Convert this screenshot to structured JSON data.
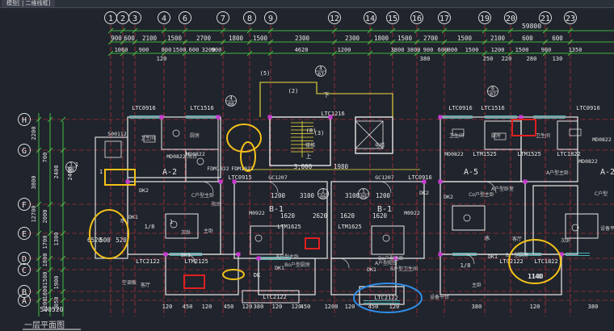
{
  "window": {
    "tab_label": "模型[ | 二维线框]"
  },
  "grid_axes": {
    "top": [
      "1",
      "2",
      "3",
      "4",
      "6",
      "7",
      "8",
      "9",
      "12",
      "14",
      "15",
      "16",
      "17",
      "19",
      "20",
      "21",
      "23"
    ],
    "left": [
      "H",
      "G",
      "F",
      "E",
      "D",
      "C",
      "B",
      "A"
    ]
  },
  "dims": {
    "overall": "59800",
    "top_row1": [
      "900",
      "600",
      "2100",
      "1500",
      "2700",
      "1800",
      "1500",
      "2300",
      "2300",
      "1800",
      "1500",
      "2700",
      "1500",
      "2100",
      "600",
      "600"
    ],
    "top_row2": [
      "1060",
      "900",
      "800",
      "1500",
      "600",
      "3200",
      "900",
      "4620",
      "1200",
      "3800",
      "3800",
      "900",
      "600",
      "800",
      "1500",
      "1200",
      "1500",
      "900",
      "1350"
    ],
    "top_row3": [
      "120",
      "380",
      "250",
      "220",
      "280",
      "130"
    ],
    "left_col": [
      "2200",
      "700",
      "2400",
      "3800",
      "12700",
      "2000",
      "1700",
      "1800",
      "1500",
      "1800",
      "1200",
      "2400",
      "1300",
      "1900",
      "2050"
    ],
    "center": [
      "3,000",
      "1980",
      "1200",
      "3100",
      "3100",
      "1200",
      "1620",
      "2620",
      "1620",
      "1620",
      "1140",
      "6520",
      "500",
      "520"
    ],
    "bottom": [
      "120",
      "450",
      "120",
      "450",
      "120",
      "380",
      "120",
      "120",
      "450",
      "1200",
      "120",
      "450",
      "120",
      "380",
      "120",
      "380"
    ]
  },
  "labels": {
    "windows": [
      "LTC0916",
      "LTC1516",
      "LTC1216",
      "LTC0916",
      "LTC1516",
      "LTC0916",
      "LTC2122",
      "LTM2125",
      "LTC2122",
      "LTC2122",
      "LTC1822",
      "LTC2122",
      "LTM1525",
      "LTM1525",
      "LTC1822",
      "LTC0915",
      "LTC0916",
      "LTM1625",
      "LTM1625"
    ],
    "doors": [
      "MD0822",
      "MD0822",
      "MD0822",
      "MD0822",
      "MD0822",
      "FDM1022",
      "FDM1022",
      "GC1207",
      "GC1207",
      "M0922",
      "M0922",
      "500112",
      "DK1",
      "DK1",
      "DK1",
      "DK1",
      "DK2",
      "DK2",
      "DK2",
      "DK1"
    ],
    "rooms": [
      "A-2",
      "B-1",
      "B-1",
      "A-5",
      "A-2",
      "卫生间",
      "卫生间",
      "卫生间",
      "厨房",
      "厨房",
      "阳台",
      "阳台",
      "主卧",
      "主卧",
      "次卧",
      "次卧",
      "客厅",
      "客厅",
      "B户型主卧",
      "C户型主卧",
      "A户型主卧",
      "A户型阳台",
      "A户型卧室",
      "B户型厨房",
      "B户型卫生间",
      "Bo户型主卧",
      "Bo户型厨房",
      "Co户型主卧",
      "C户型",
      "楼梯",
      "电梯",
      "设备平台",
      "空调板",
      "设备平台"
    ],
    "section_marks": [
      "4",
      "07",
      "4",
      "08",
      "6",
      "07",
      "1",
      "08",
      "2",
      "08",
      "1",
      "09"
    ],
    "misc": [
      "(5)",
      "(2)",
      "(8)",
      "(3)",
      "1",
      "1",
      "1",
      "DK",
      "1/8",
      "1/8",
      "水",
      "水",
      "下",
      "上",
      "500520",
      "1140"
    ],
    "title": "一层平面图"
  },
  "colors": {
    "background": "#20242c",
    "grid_line": "#e0343e",
    "wall": "#e8e8e8",
    "dim_line": "#49e449",
    "window": "#56e0e0",
    "text_yellow": "#f0e040",
    "text_green": "#49e449",
    "highlight_yellow": "#f3c21a",
    "highlight_red": "#e02020",
    "highlight_blue": "#2f8ee8"
  }
}
